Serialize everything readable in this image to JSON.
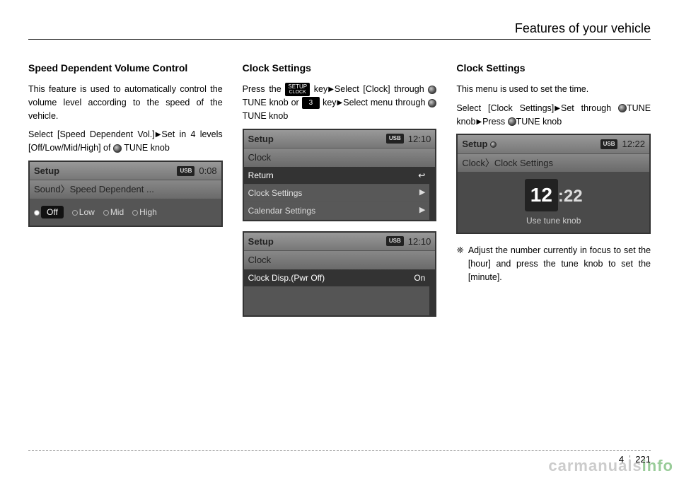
{
  "header": {
    "chapter_title": "Features of your vehicle"
  },
  "col1": {
    "heading": "Speed Dependent Volume Control",
    "para1": "This feature is used to automatically control the volume level according to the speed of the vehicle.",
    "para2a": "Select [Speed Dependent Vol.]",
    "para2b": "Set in 4 levels [Off/Low/Mid/High] of ",
    "para2c": "TUNE knob",
    "screen": {
      "title": "Setup",
      "usb": "USB",
      "time": "0:08",
      "breadcrumb": "Sound〉Speed Dependent ...",
      "options": {
        "off": "Off",
        "low": "Low",
        "mid": "Mid",
        "high": "High"
      }
    }
  },
  "col2": {
    "heading": "Clock Settings",
    "para1a": "Press the ",
    "para1b": " key",
    "para1c": "Select [Clock] through ",
    "para1d": " TUNE knob or ",
    "para1e": " key",
    "para1f": "Select menu through ",
    "para1g": "TUNE knob",
    "setup_key_top": "SETUP",
    "setup_key_bottom": "CLOCK",
    "num_key": "3",
    "screen1": {
      "title": "Setup",
      "usb": "USB",
      "time": "12:10",
      "sub": "Clock",
      "row_return": "Return",
      "row_clock": "Clock Settings",
      "row_calendar": "Calendar Settings"
    },
    "screen2": {
      "title": "Setup",
      "usb": "USB",
      "time": "12:10",
      "sub": "Clock",
      "row_disp": "Clock Disp.(Pwr Off)",
      "row_disp_val": "On"
    }
  },
  "col3": {
    "heading": "Clock Settings",
    "para1": "This menu is used to set the time.",
    "para2a": "Select [Clock Settings]",
    "para2b": "Set through ",
    "para2c": "TUNE knob",
    "para2d": "Press ",
    "para2e": "TUNE knob",
    "screen": {
      "title": "Setup",
      "usb": "USB",
      "time": "12:22",
      "breadcrumb": "Clock〉Clock Settings",
      "hour": "12",
      "minute": ":22",
      "hint": "Use tune knob"
    },
    "note_symbol": "❈",
    "note_text": "Adjust the number currently in focus to set the [hour] and press the tune knob to set the [minute]."
  },
  "footer": {
    "page_chapter": "4",
    "page_number": "221"
  },
  "watermark": {
    "part1": "carmanuals",
    "part2": "info"
  }
}
